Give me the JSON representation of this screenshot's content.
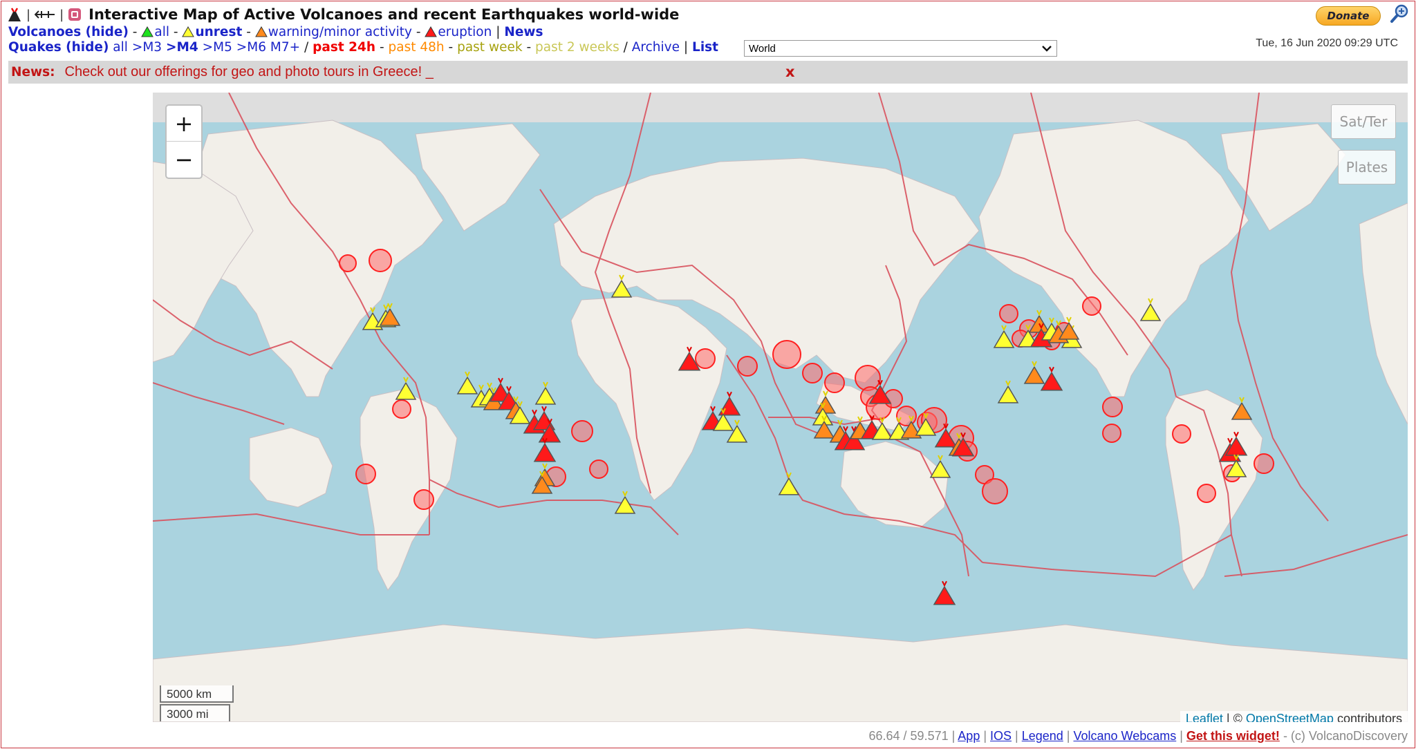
{
  "header": {
    "title": "Interactive Map of Active Volcanoes and recent Earthquakes world-wide",
    "separator": "|",
    "donate_label": "Donate",
    "datetime": "Tue, 16 Jun 2020 09:29 UTC"
  },
  "volcano_row": {
    "label": "Volcanoes (hide)",
    "all": "all",
    "unrest": "unrest",
    "warning": "warning/minor activity",
    "eruption": "eruption",
    "news": "News"
  },
  "quake_row": {
    "label": "Quakes (hide)",
    "filters": [
      "all",
      ">M3",
      ">M4",
      ">M5",
      ">M6",
      "M7+"
    ],
    "periods": [
      "past 24h",
      "past 48h",
      "past week",
      "past 2 weeks"
    ],
    "archive": "Archive",
    "list": "List",
    "region_selected": "World"
  },
  "news": {
    "label": "News:",
    "text": "Check out our offerings for geo and photo tours in Greece! _",
    "close": "x"
  },
  "map": {
    "zoom_in": "+",
    "zoom_out": "−",
    "sat_ter": "Sat/Ter",
    "plates": "Plates",
    "scale_km": "5000 km",
    "scale_mi": "3000 mi",
    "attribution_leaflet": "Leaflet",
    "attribution_sep": " | © ",
    "attribution_osm": "OpenStreetMap",
    "attribution_tail": " contributors",
    "colors": {
      "eruption": "#ff1a1a",
      "warning": "#ff8a1c",
      "unrest": "#ffff33",
      "quake": "#ff6a6a",
      "ocean": "#aad3df",
      "land": "#f2efe9",
      "plates": "#d9525e"
    },
    "volcano_icon": "triangle-volcano-icon",
    "quake_icon": "circle-quake-icon"
  },
  "footer": {
    "coords": "66.64 / 59.571",
    "links": [
      "App",
      "IOS",
      "Legend",
      "Volcano Webcams"
    ],
    "widget": "Get this widget!",
    "copyright": "- (c) VolcanoDiscovery"
  }
}
